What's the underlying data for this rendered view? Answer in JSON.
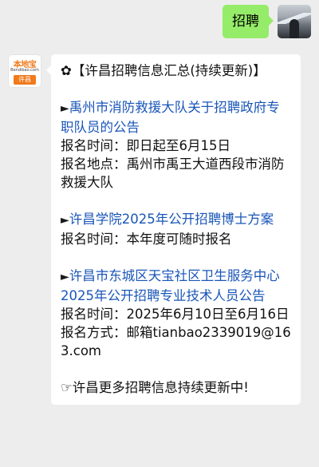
{
  "outgoing": {
    "text": "招聘"
  },
  "brand_avatar": {
    "name": "本地宝",
    "sub": "Bendibao.com",
    "tag": "许昌"
  },
  "message": {
    "title_symbol": "✿",
    "title": "【许昌招聘信息汇总(持续更新)】",
    "items": [
      {
        "marker": "►",
        "link": "禹州市消防救援大队关于招聘政府专职队员的公告",
        "lines": [
          "报名时间：即日起至6月15日",
          "报名地点：禹州市禹王大道西段市消防救援大队"
        ]
      },
      {
        "marker": "►",
        "link": "许昌学院2025年公开招聘博士方案",
        "lines": [
          "报名时间：本年度可随时报名"
        ]
      },
      {
        "marker": "►",
        "link": "许昌市东城区天宝社区卫生服务中心2025年公开招聘专业技术人员公告",
        "lines": [
          "报名时间：2025年6月10日至6月16日"
        ],
        "email_prefix": "报名方式：邮箱",
        "email": "tianbao2339019@163.com"
      }
    ],
    "footer_symbol": "☞",
    "footer": "许昌更多招聘信息持续更新中!"
  }
}
